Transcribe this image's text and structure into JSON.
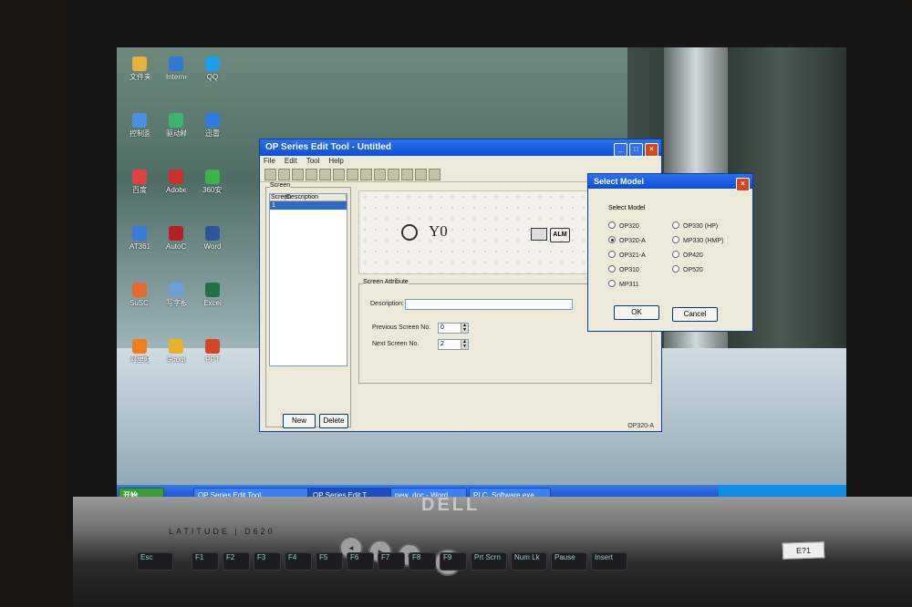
{
  "desktop": {
    "icons": [
      {
        "label": "文件夹",
        "color": "#e9b03a"
      },
      {
        "label": "控制面板",
        "color": "#4a90e2"
      },
      {
        "label": "百度",
        "color": "#e54040"
      },
      {
        "label": "AT3610",
        "color": "#3a7bd5"
      },
      {
        "label": "SuSCSN",
        "color": "#e26a2c"
      },
      {
        "label": "阿里旺旺",
        "color": "#f07c1e"
      },
      {
        "label": "Internet Explorer",
        "color": "#2f78d6"
      },
      {
        "label": "驱动精灵",
        "color": "#3cb371"
      },
      {
        "label": "Adobe Reader 11",
        "color": "#c8312b"
      },
      {
        "label": "AutoCAD",
        "color": "#b22222"
      },
      {
        "label": "写字板",
        "color": "#6a9fd8"
      },
      {
        "label": "Google Chrome",
        "color": "#e8b12b"
      },
      {
        "label": "QQ",
        "color": "#1aa0e8"
      },
      {
        "label": "迅雷",
        "color": "#2a7be4"
      },
      {
        "label": "360安全",
        "color": "#3bb24a"
      },
      {
        "label": "Word",
        "color": "#2b579a"
      },
      {
        "label": "Excel",
        "color": "#217346"
      },
      {
        "label": "PPT",
        "color": "#d24726"
      }
    ]
  },
  "taskbar": {
    "start_label": "开始",
    "buttons": [
      {
        "label": "OP Series Edit Tool"
      },
      {
        "label": "OP Series Edit T"
      },
      {
        "label": "new_doc - Word"
      },
      {
        "label": "PLC_Software.exe"
      }
    ]
  },
  "app": {
    "title": "OP Series Edit Tool - Untitled",
    "menu": [
      "File",
      "Edit",
      "Tool",
      "Help"
    ],
    "screen_panel": {
      "title": "Screen",
      "columns": [
        "Screen",
        "Description"
      ],
      "rows": [
        {
          "screen": "1",
          "description": ""
        }
      ],
      "new_label": "New",
      "delete_label": "Delete"
    },
    "canvas": {
      "coil_label": "Y0",
      "alarm_label": "ALM"
    },
    "attributes": {
      "title": "Screen Attribute",
      "description_label": "Description:",
      "description_value": "",
      "prev_label": "Previous Screen No.",
      "prev_value": "0",
      "next_label": "Next Screen No.",
      "next_value": "2"
    },
    "status": "OP320-A"
  },
  "dialog": {
    "title": "Select Model",
    "group_label": "Select Model",
    "options_left": [
      {
        "label": "OP320",
        "selected": false
      },
      {
        "label": "OP320-A",
        "selected": true
      },
      {
        "label": "OP321-A",
        "selected": false
      },
      {
        "label": "OP310",
        "selected": false
      },
      {
        "label": "MP311",
        "selected": false
      }
    ],
    "options_right": [
      {
        "label": "OP330 (HP)",
        "selected": false
      },
      {
        "label": "MP330 (HMP)",
        "selected": false
      },
      {
        "label": "OP420",
        "selected": false
      },
      {
        "label": "OP520",
        "selected": false
      }
    ],
    "ok_label": "OK",
    "cancel_label": "Cancel"
  },
  "laptop": {
    "brand": "DELL",
    "model": "LATITUDE | D620",
    "sticker": "E?1"
  },
  "keyboard": {
    "keys": [
      "Esc",
      "F1",
      "F2",
      "F3",
      "F4",
      "F5",
      "F6",
      "F7",
      "F8",
      "F9",
      "Prt Scrn",
      "Num Lk",
      "Pause",
      "Insert"
    ]
  }
}
